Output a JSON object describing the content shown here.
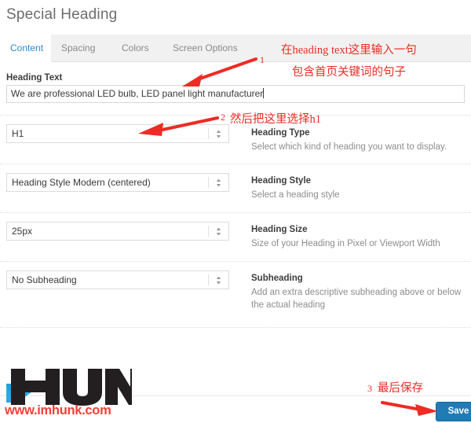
{
  "header": {
    "title": "Special Heading"
  },
  "tabs": [
    {
      "label": "Content",
      "active": true
    },
    {
      "label": "Spacing",
      "active": false
    },
    {
      "label": "Colors",
      "active": false
    },
    {
      "label": "Screen Options",
      "active": false
    }
  ],
  "fields": {
    "heading_text": {
      "label": "Heading Text",
      "value": "We are professional  LED bulb, LED panel light manufacturer"
    },
    "heading_type": {
      "value": "H1",
      "desc_title": "Heading Type",
      "desc_text": "Select which kind of heading you want to display."
    },
    "heading_style": {
      "value": "Heading Style Modern (centered)",
      "desc_title": "Heading Style",
      "desc_text": "Select a heading style"
    },
    "heading_size": {
      "value": "25px",
      "desc_title": "Heading Size",
      "desc_text": "Size of your Heading in Pixel or Viewport Width"
    },
    "subheading": {
      "value": "No Subheading",
      "desc_title": "Subheading",
      "desc_text": "Add an extra descriptive subheading above or below the actual heading"
    }
  },
  "footer": {
    "logo_text": "HUNK",
    "logo_url": "www.imhunk.com",
    "save_label": "Save"
  },
  "annotations": [
    {
      "num": "1",
      "line1": "在heading text这里输入一句",
      "line2": "包含首页关键词的句子"
    },
    {
      "num": "2",
      "line1": "然后把这里选择h1"
    },
    {
      "num": "3",
      "line1": "最后保存"
    }
  ],
  "colors": {
    "accent_blue": "#2e8bcc",
    "annotation_red": "#ee2b24",
    "save_button": "#1f7cb4",
    "logo_red": "#ef4136",
    "logo_blue": "#29abe2"
  }
}
